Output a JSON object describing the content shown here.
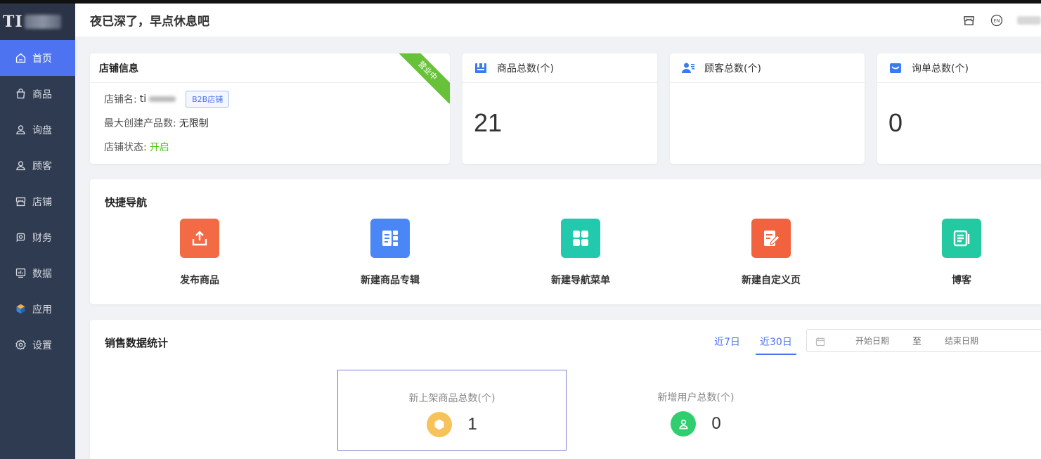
{
  "header": {
    "greeting": "夜已深了，早点休息吧"
  },
  "sidebar": {
    "logo_text": "TI",
    "items": [
      {
        "label": "首页",
        "icon": "home-icon",
        "active": true
      },
      {
        "label": "商品",
        "icon": "shopping-bag-icon"
      },
      {
        "label": "询盘",
        "icon": "user-icon"
      },
      {
        "label": "顾客",
        "icon": "user-icon"
      },
      {
        "label": "店铺",
        "icon": "store-icon"
      },
      {
        "label": "财务",
        "icon": "finance-icon"
      },
      {
        "label": "数据",
        "icon": "monitor-chart-icon"
      },
      {
        "label": "应用",
        "icon": "cube-icon"
      },
      {
        "label": "设置",
        "icon": "gear-icon"
      }
    ]
  },
  "store_info": {
    "title": "店铺信息",
    "ribbon": "营业中",
    "name_label": "店铺名:",
    "name_value": "ti",
    "tag": "B2B店铺",
    "max_products_label": "最大创建产品数:",
    "max_products_value": "无限制",
    "status_label": "店铺状态:",
    "status_value": "开启"
  },
  "stats": [
    {
      "label": "商品总数(个)",
      "value": "21",
      "icon": "product-icon",
      "color": "#3a7bf0"
    },
    {
      "label": "顾客总数(个)",
      "value": "",
      "icon": "customer-icon",
      "color": "#3a7bf0"
    },
    {
      "label": "询单总数(个)",
      "value": "0",
      "icon": "inbox-icon",
      "color": "#3a7bf0"
    }
  ],
  "quick_nav": {
    "title": "快捷导航",
    "items": [
      {
        "label": "发布商品",
        "icon": "upload-icon",
        "color": "#f26b45"
      },
      {
        "label": "新建商品专辑",
        "icon": "album-icon",
        "color": "#4a86f5"
      },
      {
        "label": "新建导航菜单",
        "icon": "grid-menu-icon",
        "color": "#23c9ad"
      },
      {
        "label": "新建自定义页",
        "icon": "edit-page-icon",
        "color": "#f2623f"
      },
      {
        "label": "博客",
        "icon": "blog-icon",
        "color": "#23c9a0"
      }
    ]
  },
  "sales": {
    "title": "销售数据统计",
    "range_tabs": [
      "近7日",
      "近30日"
    ],
    "active_tab": "近30日",
    "start_placeholder": "开始日期",
    "separator": "至",
    "end_placeholder": "结束日期",
    "metrics": [
      {
        "label": "新上架商品总数(个)",
        "value": "1",
        "color": "#f7c25a"
      },
      {
        "label": "新增用户总数(个)",
        "value": "0",
        "color": "#2fcf70"
      }
    ]
  }
}
